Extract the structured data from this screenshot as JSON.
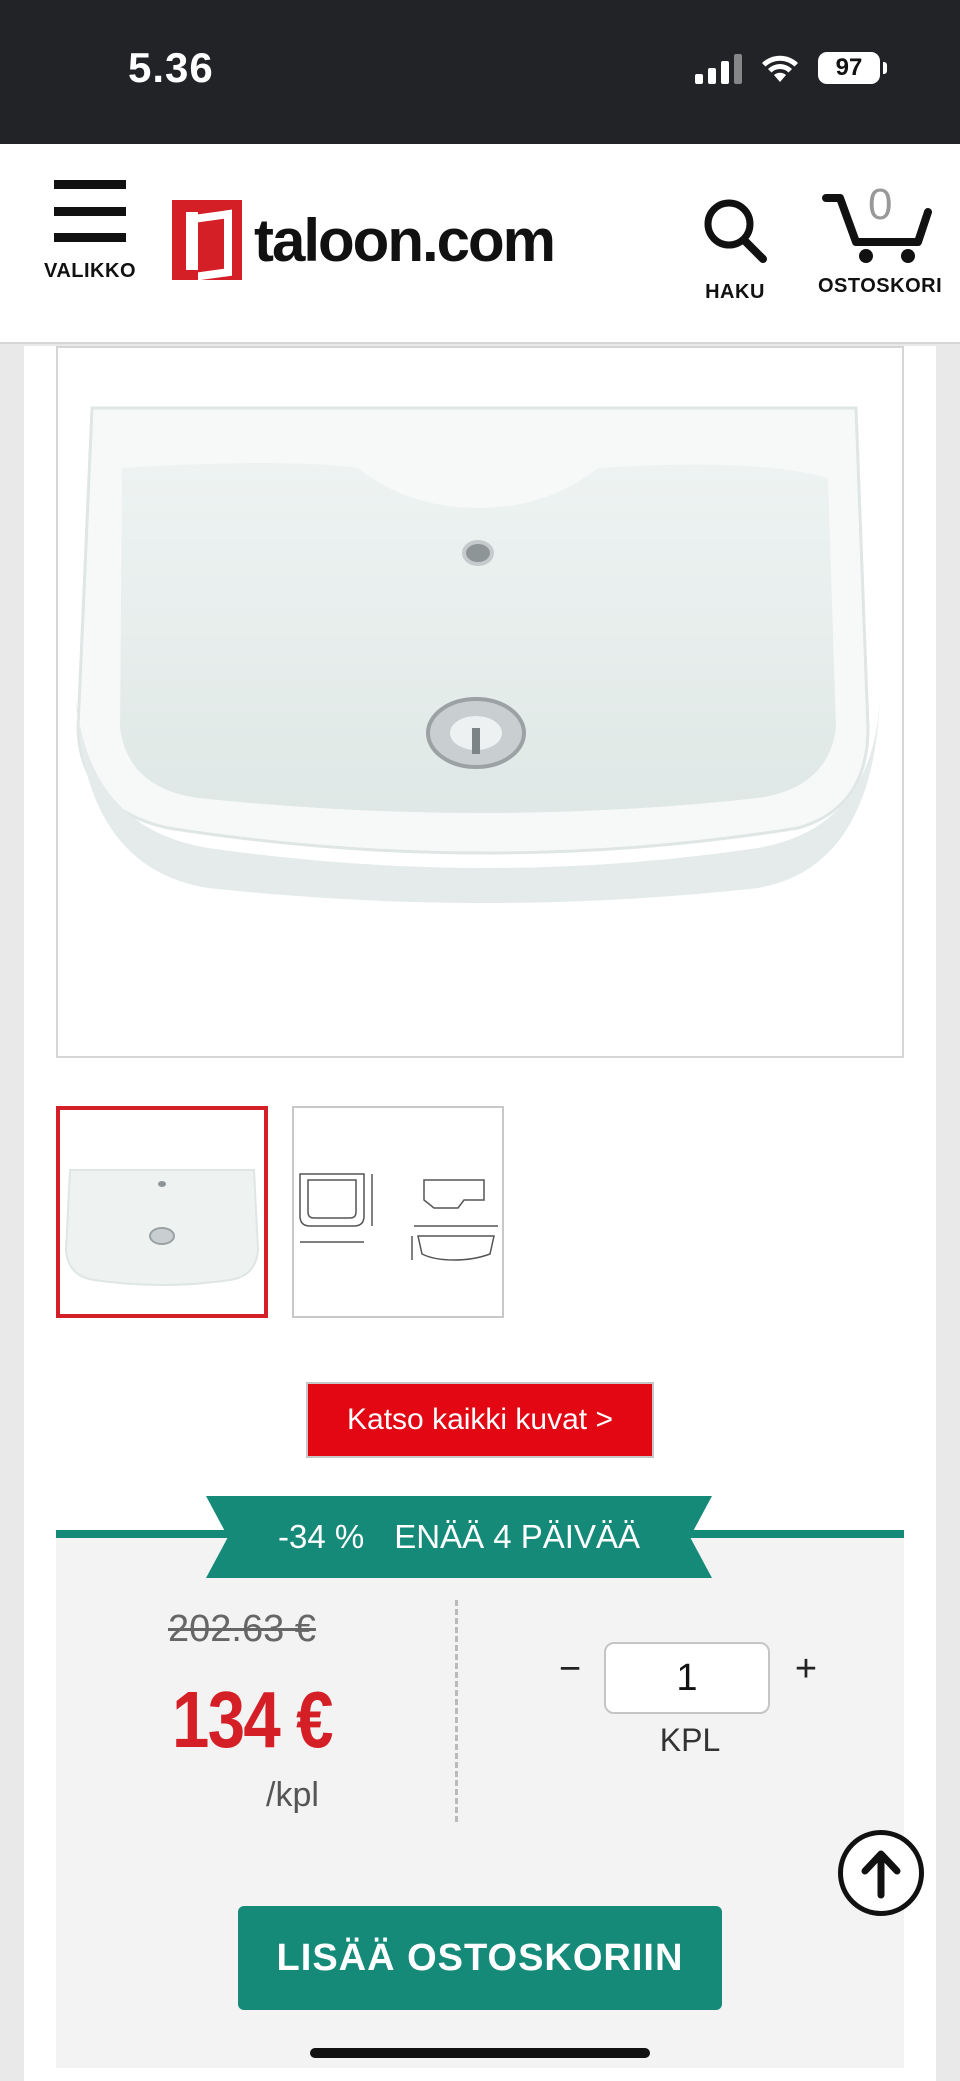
{
  "status_bar": {
    "time": "5.36",
    "battery": "97"
  },
  "header": {
    "menu_label": "VALIKKO",
    "logo_text": "taloon.com",
    "search_label": "HAKU",
    "cart_label": "OSTOSKORI",
    "cart_count": "0"
  },
  "gallery": {
    "view_all_label": "Katso kaikki kuvat >"
  },
  "promo": {
    "discount": "-34 %",
    "remaining": "ENÄÄ 4 PÄIVÄÄ"
  },
  "pricing": {
    "old_price": "202.63 €",
    "price": "134 €",
    "per_unit": "/kpl"
  },
  "quantity": {
    "minus": "−",
    "value": "1",
    "plus": "+",
    "unit": "KPL"
  },
  "actions": {
    "add_to_cart": "LISÄÄ OSTOSKORIIN"
  },
  "colors": {
    "brand_red": "#d41f26",
    "accent_teal": "#168a79",
    "status_bar": "#212326"
  }
}
